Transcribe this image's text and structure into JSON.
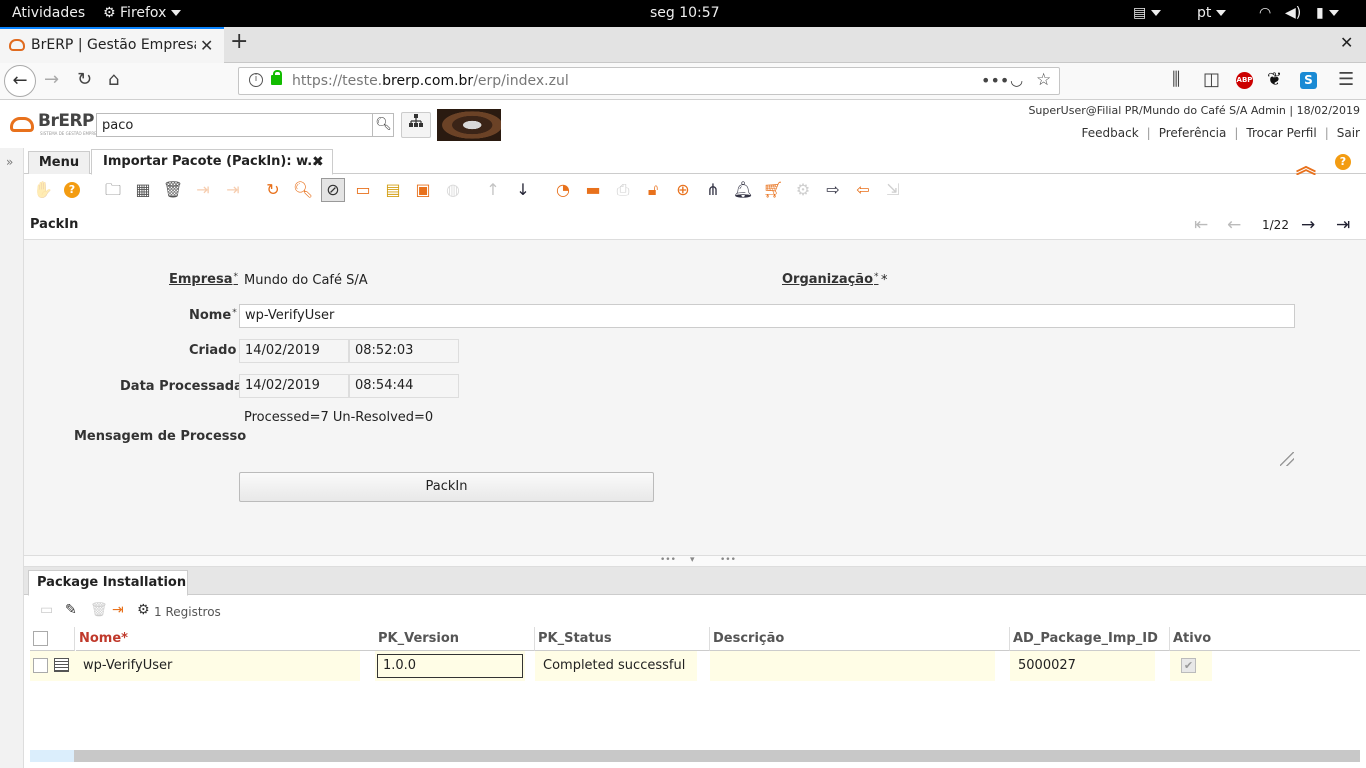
{
  "system_bar": {
    "activities": "Atividades",
    "app_menu": "Firefox",
    "clock": "seg 10:57",
    "language": "pt"
  },
  "browser": {
    "tab_title": "BrERP | Gestão Empresa",
    "url_prefix": "https://teste.",
    "url_domain": "brerp.com.br",
    "url_path": "/erp/index.zul",
    "adblock_label": "ABP",
    "ext_s_label": "S"
  },
  "app": {
    "logo_text": "BrERP",
    "logo_sub": "SISTEMA DE GESTÃO EMPRESARIAL",
    "search_value": "paco",
    "user_info": "SuperUser@Filial PR/Mundo do Café S/A Admin | 18/02/2019",
    "links": [
      "Feedback",
      "Preferência",
      "Trocar Perfil",
      "Sair"
    ]
  },
  "window_tabs": {
    "menu": "Menu",
    "active": "Importar Pacote (PackIn): w..."
  },
  "record": {
    "title": "PackIn",
    "counter": "1/22"
  },
  "form": {
    "empresa_label": "Empresa",
    "empresa_value": "Mundo do Café S/A",
    "org_label": "Organização",
    "org_value": "*",
    "nome_label": "Nome",
    "nome_value": "wp-VerifyUser",
    "criado_label": "Criado",
    "criado_date": "14/02/2019",
    "criado_time": "08:52:03",
    "processada_label": "Data Processada",
    "processada_date": "14/02/2019",
    "processada_time": "08:54:44",
    "msg_label": "Mensagem de Processo",
    "msg_value": "Processed=7 Un-Resolved=0",
    "packin_button": "PackIn"
  },
  "detail": {
    "tab": "Package Installation",
    "records": "1 Registros",
    "columns": [
      "Nome*",
      "PK_Version",
      "PK_Status",
      "Descrição",
      "AD_Package_Imp_ID",
      "Ativo"
    ],
    "rows": [
      {
        "nome": "wp-VerifyUser",
        "version": "1.0.0",
        "status": "Completed successful",
        "descricao": "",
        "id": "5000027",
        "ativo": true
      }
    ]
  },
  "colors": {
    "accent_orange": "#e8711c",
    "firefox_blue": "#0a84ff",
    "row_highlight": "#fffde6",
    "required_red": "#c0392b"
  }
}
